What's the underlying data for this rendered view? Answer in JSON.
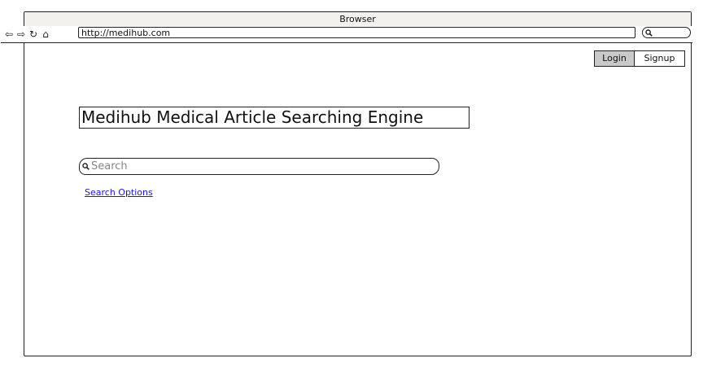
{
  "browser": {
    "title": "Browser",
    "url": "http://medihub.com",
    "nav_icons": [
      "back-arrow-icon",
      "forward-arrow-icon",
      "reload-icon",
      "home-icon"
    ]
  },
  "header": {
    "login_label": "Login",
    "signup_label": "Signup"
  },
  "main": {
    "title": "Medihub Medical Article Searching Engine",
    "search_placeholder": "Search",
    "search_options_label": "Search Options"
  }
}
